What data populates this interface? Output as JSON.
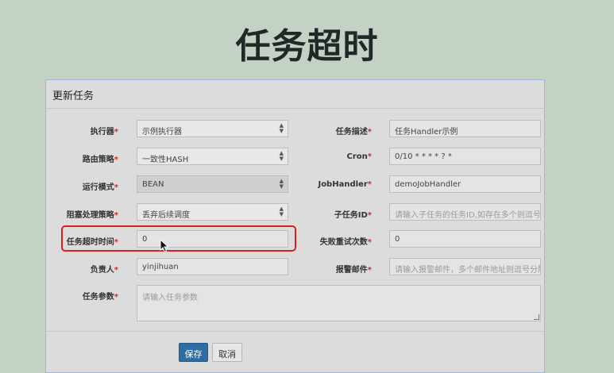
{
  "slide": {
    "title": "任务超时"
  },
  "modal": {
    "title": "更新任务",
    "left_fields": [
      {
        "label": "执行器",
        "required": "*",
        "value": "示例执行器",
        "type": "select"
      },
      {
        "label": "路由策略",
        "required": "*",
        "value": "一致性HASH",
        "type": "select"
      },
      {
        "label": "运行模式",
        "required": "*",
        "value": "BEAN",
        "type": "select-disabled"
      },
      {
        "label": "阻塞处理策略",
        "required": "*",
        "value": "丢弃后续调度",
        "type": "select"
      },
      {
        "label": "任务超时时间",
        "required": "*",
        "value": "0",
        "type": "input"
      },
      {
        "label": "负责人",
        "required": "*",
        "value": "yinjihuan",
        "type": "input"
      }
    ],
    "right_fields": [
      {
        "label": "任务描述",
        "required": "*",
        "value": "任务Handler示例",
        "placeholder": ""
      },
      {
        "label": "Cron",
        "required": "*",
        "value": "0/10 * * * * ? *",
        "placeholder": ""
      },
      {
        "label": "JobHandler",
        "required": "*",
        "value": "demoJobHandler",
        "placeholder": ""
      },
      {
        "label": "子任务ID",
        "required": "*",
        "value": "",
        "placeholder": "请输入子任务的任务ID,如存在多个则逗号分隔"
      },
      {
        "label": "失败重试次数",
        "required": "*",
        "value": "0",
        "placeholder": ""
      },
      {
        "label": "报警邮件",
        "required": "*",
        "value": "",
        "placeholder": "请输入报警邮件，多个邮件地址则逗号分隔"
      }
    ],
    "params": {
      "label": "任务参数",
      "required": "*",
      "placeholder": "请输入任务参数"
    },
    "buttons": {
      "save": "保存",
      "cancel": "取消"
    }
  }
}
